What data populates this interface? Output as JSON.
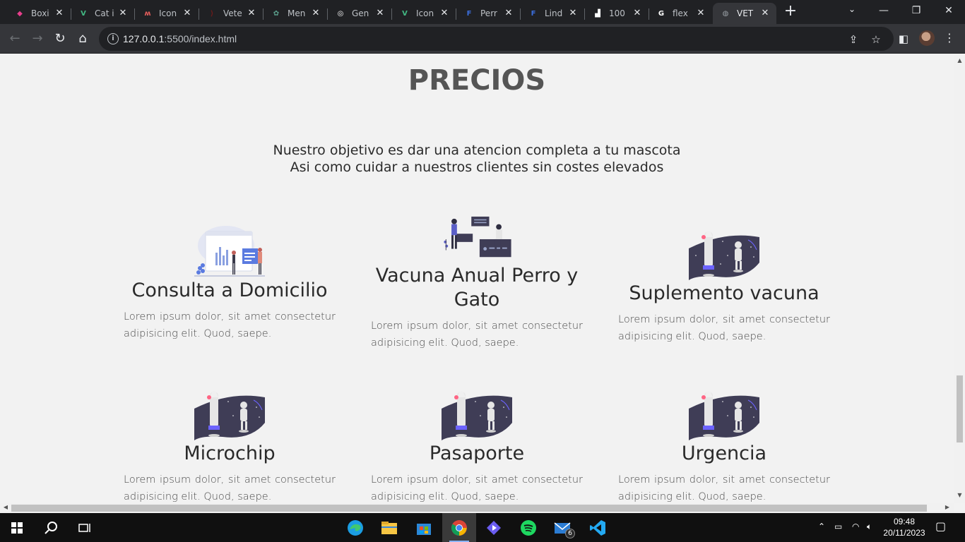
{
  "browser": {
    "tabs": [
      {
        "label": "Boxi",
        "favicon_color": "#e83e8c",
        "favicon_glyph": "◆",
        "active": false
      },
      {
        "label": "Cat i",
        "favicon_color": "#42b883",
        "favicon_glyph": "V",
        "active": false
      },
      {
        "label": "Icon",
        "favicon_color": "#e35d5b",
        "favicon_glyph": "ʍ",
        "active": false
      },
      {
        "label": "Vete",
        "favicon_color": "#6d1a1a",
        "favicon_glyph": "⟩",
        "active": false
      },
      {
        "label": "Men",
        "favicon_color": "#5a9e8b",
        "favicon_glyph": "✿",
        "active": false
      },
      {
        "label": "Gen",
        "favicon_color": "#ffffff",
        "favicon_glyph": "◎",
        "active": false
      },
      {
        "label": "Icon",
        "favicon_color": "#42b883",
        "favicon_glyph": "V",
        "active": false
      },
      {
        "label": "Perr",
        "favicon_color": "#3b6ddb",
        "favicon_glyph": "F",
        "active": false
      },
      {
        "label": "Lind",
        "favicon_color": "#3b6ddb",
        "favicon_glyph": "F",
        "active": false
      },
      {
        "label": "100",
        "favicon_color": "#ffffff",
        "favicon_glyph": "▟",
        "active": false
      },
      {
        "label": "flex",
        "favicon_color": "#ffffff",
        "favicon_glyph": "G",
        "active": false
      },
      {
        "label": "VET",
        "favicon_color": "#9aa0a6",
        "favicon_glyph": "◍",
        "active": true
      }
    ],
    "url_host": "127.0.0.1",
    "url_rest": ":5500/index.html"
  },
  "page": {
    "title": "PRECIOS",
    "intro_line1": "Nuestro objetivo es dar una atencion completa a tu mascota",
    "intro_line2": "Asi como cuidar a nuestros clientes sin costes elevados",
    "cards": [
      {
        "title": "Consulta a Domicilio",
        "text": "Lorem ipsum dolor, sit amet consectetur adipisicing elit. Quod, saepe.",
        "illustration": "analytics-dashboard"
      },
      {
        "title": "Vacuna Anual Perro y Gato",
        "text": "Lorem ipsum dolor, sit amet consectetur adipisicing elit. Quod, saepe.",
        "illustration": "team-chat"
      },
      {
        "title": "Suplemento vacuna",
        "text": "Lorem ipsum dolor, sit amet consectetur adipisicing elit. Quod, saepe.",
        "illustration": "space-rocket"
      },
      {
        "title": "Microchip",
        "text": "Lorem ipsum dolor, sit amet consectetur adipisicing elit. Quod, saepe.",
        "illustration": "space-rocket"
      },
      {
        "title": "Pasaporte",
        "text": "Lorem ipsum dolor, sit amet consectetur adipisicing elit. Quod, saepe.",
        "illustration": "space-rocket"
      },
      {
        "title": "Urgencia",
        "text": "Lorem ipsum dolor, sit amet consectetur adipisicing elit. Quod, saepe.",
        "illustration": "space-rocket"
      }
    ]
  },
  "taskbar": {
    "mail_badge": "6",
    "time": "09:48",
    "date": "20/11/2023"
  }
}
